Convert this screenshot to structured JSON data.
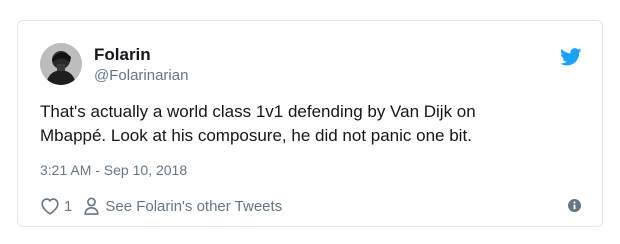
{
  "tweet": {
    "author_name": "Folarin",
    "author_handle": "@Folarinarian",
    "text_lines": [
      "That's actually a world class 1v1 defending by Van Dijk on",
      "Mbappé. Look at his composure, he did not panic one bit."
    ],
    "timestamp": "3:21 AM - Sep 10, 2018",
    "like_count": "1",
    "other_tweets_label": "See Folarin's other Tweets"
  },
  "icons": {
    "brand": "twitter-bird-icon",
    "like": "heart-icon",
    "profile": "person-icon",
    "info": "info-icon"
  },
  "colors": {
    "brand_blue": "#1da1f2",
    "text_primary": "#14171a",
    "text_secondary": "#657786",
    "border": "#e1e8ed"
  }
}
